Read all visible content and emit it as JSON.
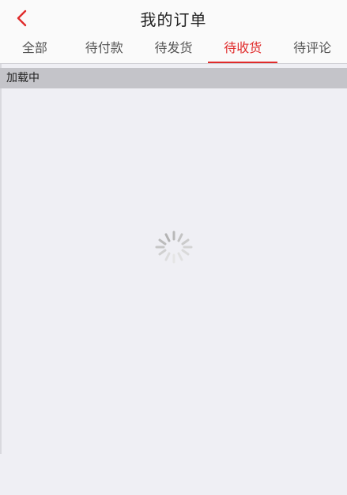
{
  "header": {
    "title": "我的订单",
    "back_icon": "chevron-left-icon",
    "accent_color": "#e02b2b"
  },
  "tabs": [
    {
      "label": "全部",
      "active": false
    },
    {
      "label": "待付款",
      "active": false
    },
    {
      "label": "待发货",
      "active": false
    },
    {
      "label": "待收货",
      "active": true
    },
    {
      "label": "待评论",
      "active": false
    }
  ],
  "status": {
    "loading_text": "加载中",
    "spinner_icon": "loading-spinner-icon"
  }
}
